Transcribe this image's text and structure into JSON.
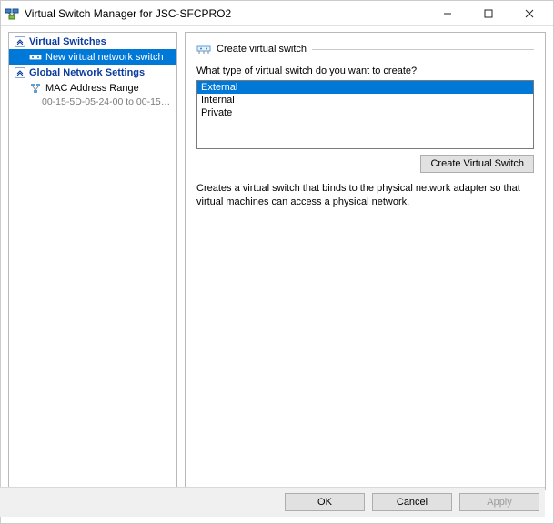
{
  "window": {
    "title": "Virtual Switch Manager for JSC-SFCPRO2"
  },
  "sidebar": {
    "sections": [
      {
        "label": "Virtual Switches",
        "items": [
          {
            "label": "New virtual network switch",
            "selected": true
          }
        ]
      },
      {
        "label": "Global Network Settings",
        "items": [
          {
            "label": "MAC Address Range",
            "sub": "00-15-5D-05-24-00 to 00-15-5D-0..."
          }
        ]
      }
    ]
  },
  "main": {
    "group_title": "Create virtual switch",
    "prompt": "What type of virtual switch do you want to create?",
    "switch_types": [
      {
        "label": "External",
        "selected": true
      },
      {
        "label": "Internal",
        "selected": false
      },
      {
        "label": "Private",
        "selected": false
      }
    ],
    "create_button": "Create Virtual Switch",
    "description": "Creates a virtual switch that binds to the physical network adapter so that virtual machines can access a physical network."
  },
  "footer": {
    "ok": "OK",
    "cancel": "Cancel",
    "apply": "Apply"
  }
}
